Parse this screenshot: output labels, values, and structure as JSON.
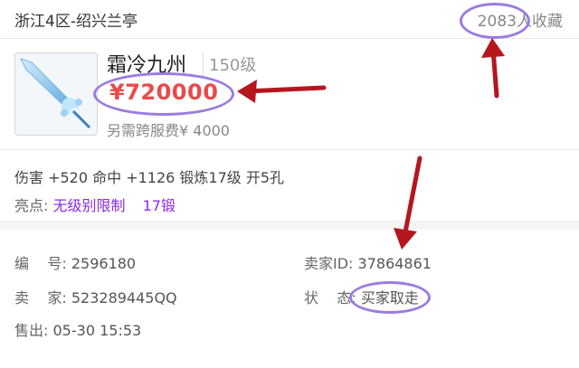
{
  "header": {
    "server": "浙江4区-绍兴兰亭",
    "favorites_count": "2083",
    "favorites_suffix": "人收藏"
  },
  "item": {
    "name": "霜冷九州",
    "level": "150级",
    "price": "¥720000",
    "transfer_fee": "另需跨服费¥ 4000",
    "stats": "伤害 +520 命中 +1126 锻炼17级 开5孔",
    "highlight_label": "亮点:",
    "highlight_value": "无级别限制",
    "highlight_tag": "17锻"
  },
  "details": {
    "id_label": "编    号:",
    "id_value": "2596180",
    "seller_id_label": "卖家ID:",
    "seller_id_value": "37864861",
    "seller_label": "卖    家:",
    "seller_value": "523289445QQ",
    "status_label": "状    态:",
    "status_value": "买家取走",
    "sold_label": "售出:",
    "sold_value": "05-30 15:53"
  },
  "colors": {
    "price": "#e94a4a",
    "highlight": "#8a2be2",
    "annotation_circle": "#9b7be0",
    "annotation_arrow": "#b5161e"
  }
}
